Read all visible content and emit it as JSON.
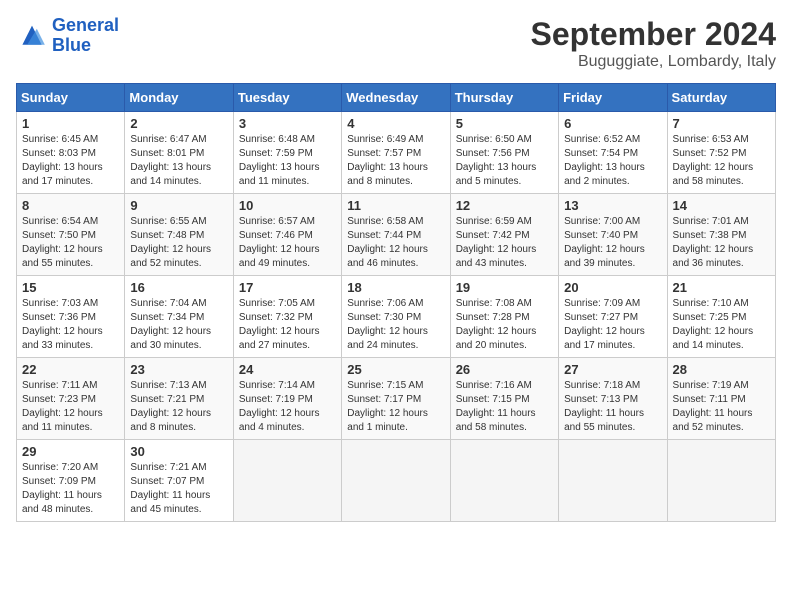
{
  "header": {
    "logo_line1": "General",
    "logo_line2": "Blue",
    "main_title": "September 2024",
    "subtitle": "Buguggiate, Lombardy, Italy"
  },
  "weekdays": [
    "Sunday",
    "Monday",
    "Tuesday",
    "Wednesday",
    "Thursday",
    "Friday",
    "Saturday"
  ],
  "weeks": [
    [
      {
        "day": "1",
        "sunrise": "6:45 AM",
        "sunset": "8:03 PM",
        "daylight": "13 hours and 17 minutes."
      },
      {
        "day": "2",
        "sunrise": "6:47 AM",
        "sunset": "8:01 PM",
        "daylight": "13 hours and 14 minutes."
      },
      {
        "day": "3",
        "sunrise": "6:48 AM",
        "sunset": "7:59 PM",
        "daylight": "13 hours and 11 minutes."
      },
      {
        "day": "4",
        "sunrise": "6:49 AM",
        "sunset": "7:57 PM",
        "daylight": "13 hours and 8 minutes."
      },
      {
        "day": "5",
        "sunrise": "6:50 AM",
        "sunset": "7:56 PM",
        "daylight": "13 hours and 5 minutes."
      },
      {
        "day": "6",
        "sunrise": "6:52 AM",
        "sunset": "7:54 PM",
        "daylight": "13 hours and 2 minutes."
      },
      {
        "day": "7",
        "sunrise": "6:53 AM",
        "sunset": "7:52 PM",
        "daylight": "12 hours and 58 minutes."
      }
    ],
    [
      {
        "day": "8",
        "sunrise": "6:54 AM",
        "sunset": "7:50 PM",
        "daylight": "12 hours and 55 minutes."
      },
      {
        "day": "9",
        "sunrise": "6:55 AM",
        "sunset": "7:48 PM",
        "daylight": "12 hours and 52 minutes."
      },
      {
        "day": "10",
        "sunrise": "6:57 AM",
        "sunset": "7:46 PM",
        "daylight": "12 hours and 49 minutes."
      },
      {
        "day": "11",
        "sunrise": "6:58 AM",
        "sunset": "7:44 PM",
        "daylight": "12 hours and 46 minutes."
      },
      {
        "day": "12",
        "sunrise": "6:59 AM",
        "sunset": "7:42 PM",
        "daylight": "12 hours and 43 minutes."
      },
      {
        "day": "13",
        "sunrise": "7:00 AM",
        "sunset": "7:40 PM",
        "daylight": "12 hours and 39 minutes."
      },
      {
        "day": "14",
        "sunrise": "7:01 AM",
        "sunset": "7:38 PM",
        "daylight": "12 hours and 36 minutes."
      }
    ],
    [
      {
        "day": "15",
        "sunrise": "7:03 AM",
        "sunset": "7:36 PM",
        "daylight": "12 hours and 33 minutes."
      },
      {
        "day": "16",
        "sunrise": "7:04 AM",
        "sunset": "7:34 PM",
        "daylight": "12 hours and 30 minutes."
      },
      {
        "day": "17",
        "sunrise": "7:05 AM",
        "sunset": "7:32 PM",
        "daylight": "12 hours and 27 minutes."
      },
      {
        "day": "18",
        "sunrise": "7:06 AM",
        "sunset": "7:30 PM",
        "daylight": "12 hours and 24 minutes."
      },
      {
        "day": "19",
        "sunrise": "7:08 AM",
        "sunset": "7:28 PM",
        "daylight": "12 hours and 20 minutes."
      },
      {
        "day": "20",
        "sunrise": "7:09 AM",
        "sunset": "7:27 PM",
        "daylight": "12 hours and 17 minutes."
      },
      {
        "day": "21",
        "sunrise": "7:10 AM",
        "sunset": "7:25 PM",
        "daylight": "12 hours and 14 minutes."
      }
    ],
    [
      {
        "day": "22",
        "sunrise": "7:11 AM",
        "sunset": "7:23 PM",
        "daylight": "12 hours and 11 minutes."
      },
      {
        "day": "23",
        "sunrise": "7:13 AM",
        "sunset": "7:21 PM",
        "daylight": "12 hours and 8 minutes."
      },
      {
        "day": "24",
        "sunrise": "7:14 AM",
        "sunset": "7:19 PM",
        "daylight": "12 hours and 4 minutes."
      },
      {
        "day": "25",
        "sunrise": "7:15 AM",
        "sunset": "7:17 PM",
        "daylight": "12 hours and 1 minute."
      },
      {
        "day": "26",
        "sunrise": "7:16 AM",
        "sunset": "7:15 PM",
        "daylight": "11 hours and 58 minutes."
      },
      {
        "day": "27",
        "sunrise": "7:18 AM",
        "sunset": "7:13 PM",
        "daylight": "11 hours and 55 minutes."
      },
      {
        "day": "28",
        "sunrise": "7:19 AM",
        "sunset": "7:11 PM",
        "daylight": "11 hours and 52 minutes."
      }
    ],
    [
      {
        "day": "29",
        "sunrise": "7:20 AM",
        "sunset": "7:09 PM",
        "daylight": "11 hours and 48 minutes."
      },
      {
        "day": "30",
        "sunrise": "7:21 AM",
        "sunset": "7:07 PM",
        "daylight": "11 hours and 45 minutes."
      },
      null,
      null,
      null,
      null,
      null
    ]
  ]
}
